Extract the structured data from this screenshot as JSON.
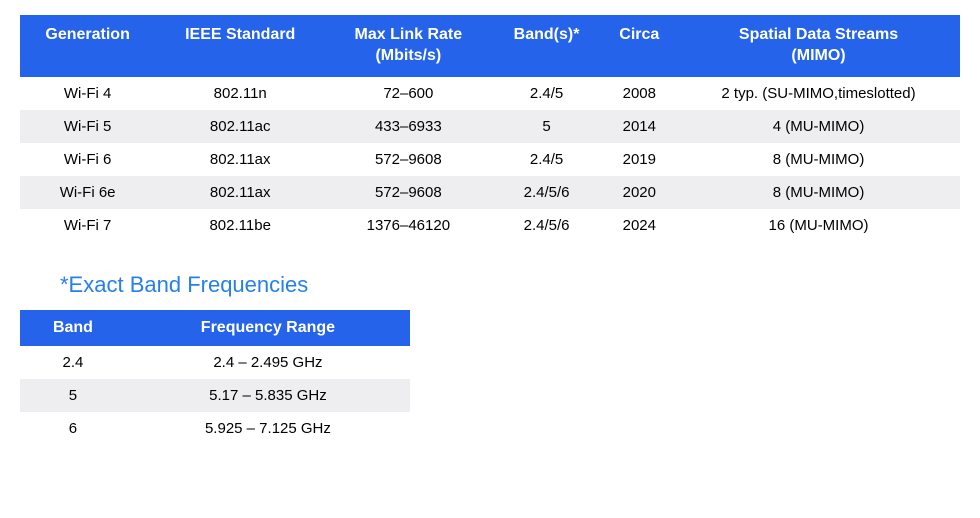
{
  "chart_data": [
    {
      "type": "table",
      "title": "",
      "columns": [
        "Generation",
        "IEEE Standard",
        "Max Link Rate (Mbits/s)",
        "Band(s)*",
        "Circa",
        "Spatial Data Streams (MIMO)"
      ],
      "rows": [
        [
          "Wi-Fi 4",
          "802.11n",
          "72–600",
          "2.4/5",
          "2008",
          "2 typ. (SU-MIMO,timeslotted)"
        ],
        [
          "Wi-Fi 5",
          "802.11ac",
          "433–6933",
          "5",
          "2014",
          "4 (MU-MIMO)"
        ],
        [
          "Wi-Fi 6",
          "802.11ax",
          "572–9608",
          "2.4/5",
          "2019",
          "8 (MU-MIMO)"
        ],
        [
          "Wi-Fi 6e",
          "802.11ax",
          "572–9608",
          "2.4/5/6",
          "2020",
          "8 (MU-MIMO)"
        ],
        [
          "Wi-Fi 7",
          "802.11be",
          "1376–46120",
          "2.4/5/6",
          "2024",
          "16 (MU-MIMO)"
        ]
      ]
    },
    {
      "type": "table",
      "title": "*Exact Band Frequencies",
      "columns": [
        "Band",
        "Frequency Range"
      ],
      "rows": [
        [
          "2.4",
          "2.4 – 2.495 GHz"
        ],
        [
          "5",
          "5.17 – 5.835 GHz"
        ],
        [
          "6",
          "5.925 – 7.125 GHz"
        ]
      ]
    }
  ],
  "main_table": {
    "headers": {
      "c0": "Generation",
      "c1": "IEEE Standard",
      "c2": "Max Link Rate\n(Mbits/s)",
      "c3": "Band(s)*",
      "c4": "Circa",
      "c5": "Spatial Data Streams\n(MIMO)"
    },
    "rows": [
      {
        "c0": "Wi-Fi 4",
        "c1": "802.11n",
        "c2": "72–600",
        "c3": "2.4/5",
        "c4": "2008",
        "c5": "2 typ. (SU-MIMO,timeslotted)"
      },
      {
        "c0": "Wi-Fi 5",
        "c1": "802.11ac",
        "c2": "433–6933",
        "c3": "5",
        "c4": "2014",
        "c5": "4 (MU-MIMO)"
      },
      {
        "c0": "Wi-Fi 6",
        "c1": "802.11ax",
        "c2": "572–9608",
        "c3": "2.4/5",
        "c4": "2019",
        "c5": "8 (MU-MIMO)"
      },
      {
        "c0": "Wi-Fi 6e",
        "c1": "802.11ax",
        "c2": "572–9608",
        "c3": "2.4/5/6",
        "c4": "2020",
        "c5": "8 (MU-MIMO)"
      },
      {
        "c0": "Wi-Fi 7",
        "c1": "802.11be",
        "c2": "1376–46120",
        "c3": "2.4/5/6",
        "c4": "2024",
        "c5": "16 (MU-MIMO)"
      }
    ]
  },
  "sub_title": "*Exact Band Frequencies",
  "sub_table": {
    "headers": {
      "c0": "Band",
      "c1": "Frequency Range"
    },
    "rows": [
      {
        "c0": "2.4",
        "c1": "2.4 – 2.495 GHz"
      },
      {
        "c0": "5",
        "c1": "5.17 – 5.835 GHz"
      },
      {
        "c0": "6",
        "c1": "5.925 – 7.125 GHz"
      }
    ]
  }
}
